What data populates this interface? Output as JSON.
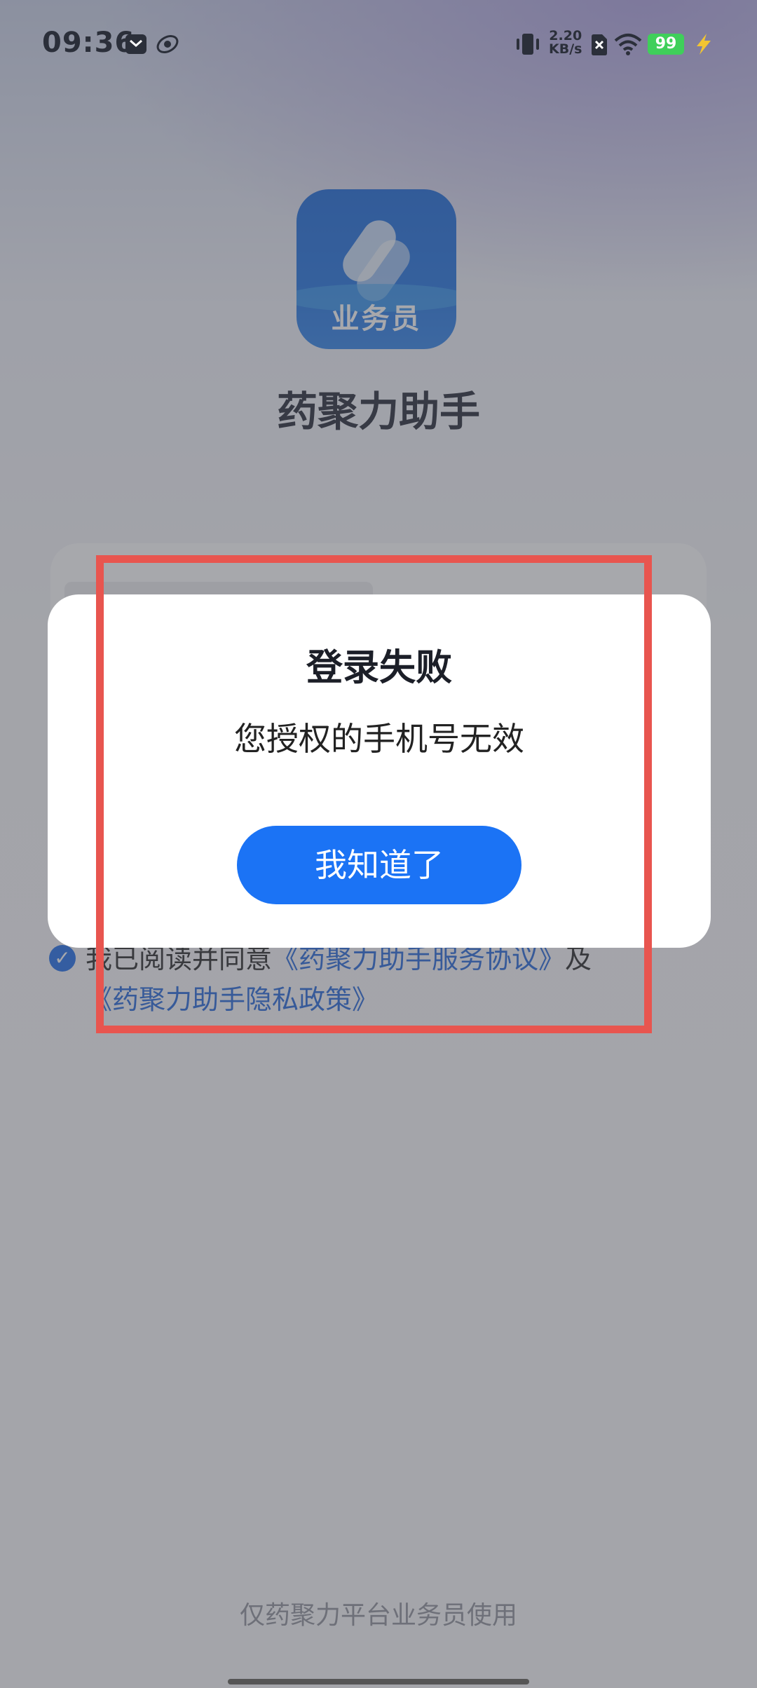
{
  "status_bar": {
    "time": "09:36",
    "net_speed_value": "2.20",
    "net_speed_unit": "KB/s",
    "battery": "99"
  },
  "app": {
    "icon_label": "业务员",
    "name": "药聚力助手"
  },
  "agreement": {
    "prefix": "我已阅读并同意",
    "service_link": "《药聚力助手服务协议》",
    "conjunction": "及",
    "privacy_link": "《药聚力助手隐私政策》",
    "checked": true
  },
  "dialog": {
    "title": "登录失败",
    "message": "您授权的手机号无效",
    "button": "我知道了"
  },
  "footer": "仅药聚力平台业务员使用",
  "colors": {
    "primary": "#1b73f5",
    "link": "#1f63d8",
    "annotation": "#e8554f"
  }
}
